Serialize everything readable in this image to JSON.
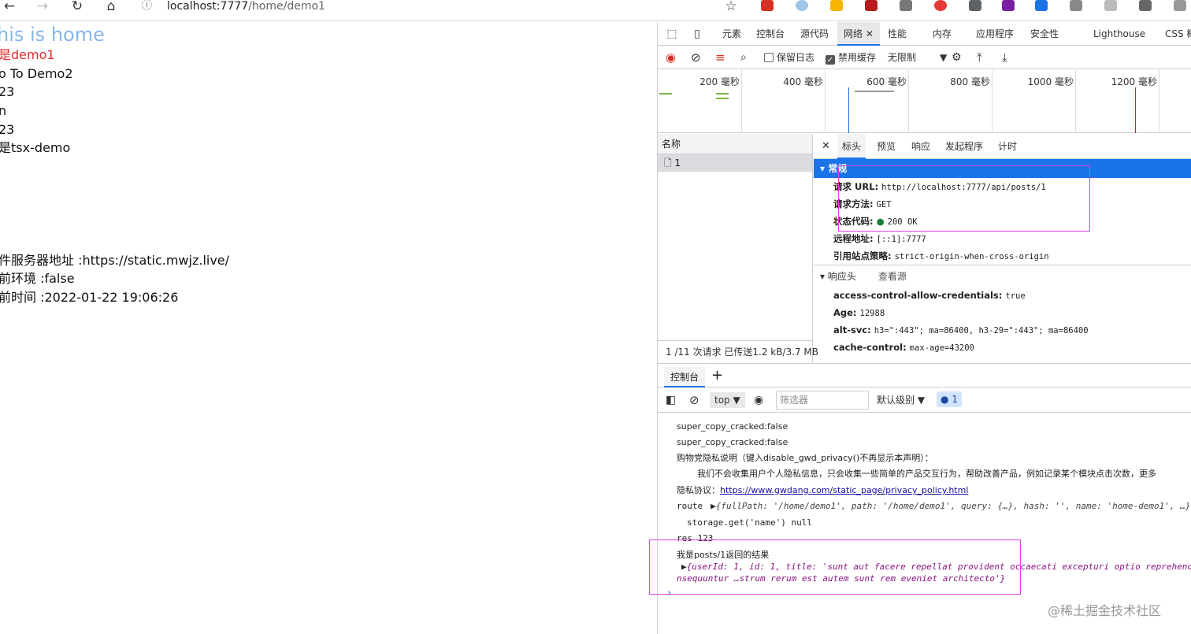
{
  "browser": {
    "address_scheme_host": "localhost:7777",
    "address_path": "/home/demo1",
    "info_icon": "ⓘ"
  },
  "page": {
    "lines": [
      "his is home",
      "是demo1",
      "o To Demo2",
      "23",
      "n",
      "23",
      "是tsx-demo",
      "件服务器地址 :https://static.mwjz.live/",
      "前环境 :false",
      "前时间 :2022-01-22 19:06:26"
    ]
  },
  "devtools": {
    "tabs": [
      "元素",
      "控制台",
      "源代码",
      "网络",
      "性能",
      "内存",
      "应用程序",
      "安全性",
      "Lighthouse",
      "CSS 概"
    ],
    "active_tab": "网络",
    "network_toolbar": {
      "preserve_log": "保留日志",
      "disable_cache": "禁用缓存",
      "throttle": "无限制"
    },
    "timeline_labels": [
      "200 毫秒",
      "400 毫秒",
      "600 毫秒",
      "800 毫秒",
      "1000 毫秒",
      "1200 毫秒"
    ],
    "name_header": "名称",
    "request_name": "1",
    "status_bar": "1 /11 次请求  已传送1.2 kB/3.7 MB",
    "detail_tabs": [
      "标头",
      "预览",
      "响应",
      "发起程序",
      "计时"
    ],
    "general_title": "常规",
    "general": [
      {
        "k": "请求 URL:",
        "v": "http://localhost:7777/api/posts/1"
      },
      {
        "k": "请求方法:",
        "v": "GET"
      },
      {
        "k": "状态代码:",
        "v": "200 OK"
      },
      {
        "k": "远程地址:",
        "v": "[::1]:7777"
      },
      {
        "k": "引用站点策略:",
        "v": "strict-origin-when-cross-origin"
      }
    ],
    "response_headers_title": "响应头",
    "view_source": "查看源",
    "response_headers": [
      {
        "k": "access-control-allow-credentials:",
        "v": "true"
      },
      {
        "k": "Age:",
        "v": "12988"
      },
      {
        "k": "alt-svc:",
        "v": "h3=\":443\"; ma=86400, h3-29=\":443\"; ma=86400"
      },
      {
        "k": "cache-control:",
        "v": "max-age=43200"
      }
    ]
  },
  "console": {
    "tab": "控制台",
    "context": "top",
    "filter_placeholder": "筛选器",
    "level": "默认级别",
    "badge": "1",
    "lines": [
      "super_copy_cracked:false",
      "super_copy_cracked:false",
      "购物党隐私说明（键入disable_gwd_privacy()不再显示本声明）：",
      "我们不会收集用户个人隐私信息，只会收集一些简单的产品交互行为，帮助改善产品，例如记录某个模块点击次数，更多",
      "隐私协议：",
      "https://www.gwdang.com/static_page/privacy_policy.html",
      "route",
      "{fullPath: '/home/demo1', path: '/home/demo1', query: {…}, hash: '', name: 'home-demo1', …}",
      "storage.get('name') null",
      "res 123",
      "我是posts/1返回的结果",
      "{userId: 1, id: 1, title: 'sunt aut facere repellat provident occaecati excepturi optio reprehende",
      "nsequuntur …strum rerum est autem sunt rem eveniet architecto'}"
    ]
  },
  "watermark": "@稀土掘金技术社区"
}
